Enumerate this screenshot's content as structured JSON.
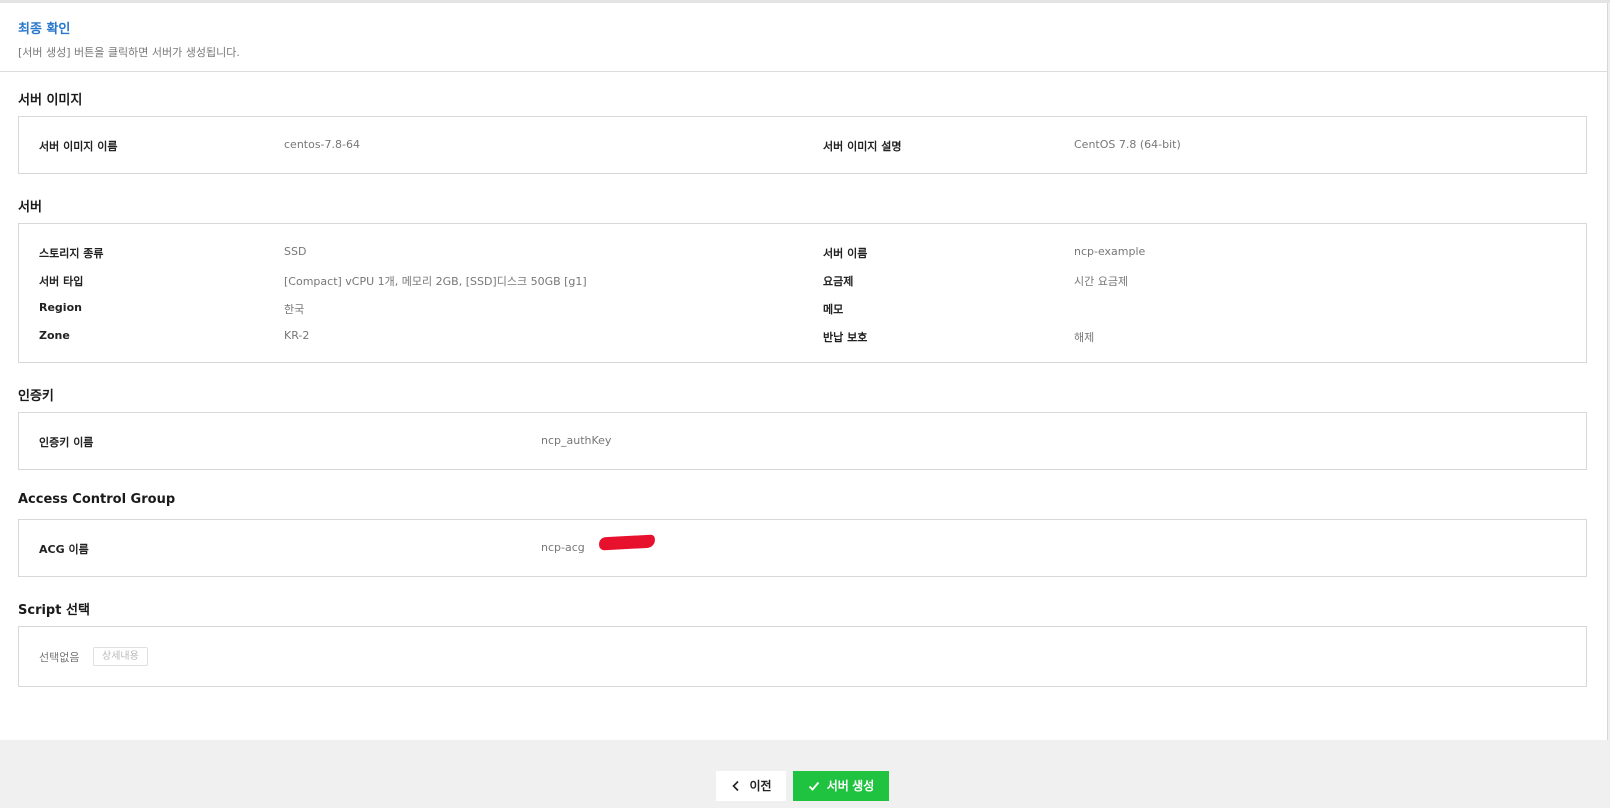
{
  "header": {
    "title": "최종 확인",
    "description": "[서버 생성] 버튼을 클릭하면 서버가 생성됩니다."
  },
  "sections": {
    "image": {
      "title": "서버 이미지",
      "rows": [
        {
          "label": "서버 이미지 이름",
          "value": "centos-7.8-64"
        },
        {
          "label": "서버 이미지 설명",
          "value": "CentOS 7.8 (64-bit)"
        }
      ]
    },
    "server": {
      "title": "서버",
      "rows": [
        {
          "label": "스토리지 종류",
          "value": "SSD"
        },
        {
          "label": "서버 타입",
          "value": "[Compact] vCPU 1개, 메모리 2GB, [SSD]디스크 50GB [g1]"
        },
        {
          "label": "Region",
          "value": "한국"
        },
        {
          "label": "Zone",
          "value": "KR-2"
        },
        {
          "label": "서버 이름",
          "value": "ncp-example"
        },
        {
          "label": "요금제",
          "value": "시간 요금제"
        },
        {
          "label": "메모",
          "value": ""
        },
        {
          "label": "반납 보호",
          "value": "해제"
        }
      ]
    },
    "authkey": {
      "title": "인증키",
      "rows": [
        {
          "label": "인증키 이름",
          "value": "ncp_authKey"
        }
      ]
    },
    "acg": {
      "title": "Access Control Group",
      "rows": [
        {
          "label": "ACG 이름",
          "value": "ncp-acg"
        }
      ]
    },
    "script": {
      "title": "Script 선택",
      "selected": "선택없음",
      "detail_button": "상세내용"
    }
  },
  "footer": {
    "prev_label": "이전",
    "create_label": "서버 생성"
  },
  "icons": {
    "prev": "chevron-left-icon",
    "create": "check-icon"
  },
  "colors": {
    "title": "#2a78cc",
    "create_button": "#1fc33f",
    "redaction": "#e8112d"
  }
}
